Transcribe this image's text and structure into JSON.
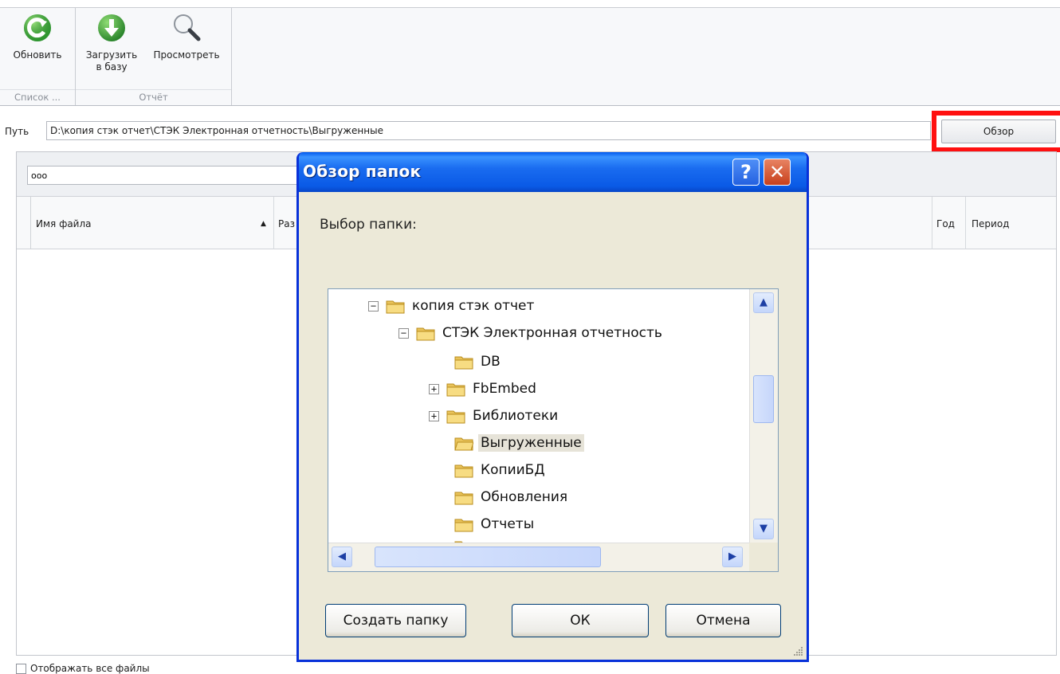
{
  "ribbon": {
    "refresh_label": "Обновить",
    "list_group_caption": "Список ...",
    "upload_label_line1": "Загрузить",
    "upload_label_line2": "в базу",
    "view_label": "Просмотреть",
    "report_group_caption": "Отчёт"
  },
  "path": {
    "label": "Путь",
    "value": "D:\\копия стэк отчет\\СТЭК Электронная отчетность\\Выгруженные",
    "browse_button": "Обзор"
  },
  "grid": {
    "filter_value": "ооо",
    "columns": [
      "Имя файла",
      "Раз",
      "Год",
      "Период"
    ],
    "show_all_label": "Отображать все файлы"
  },
  "dialog": {
    "title": "Обзор папок",
    "help_glyph": "?",
    "close_glyph": "✕",
    "caption": "Выбор папки:",
    "tree": [
      {
        "label": "копия стэк отчет",
        "expander": "−"
      },
      {
        "label": "СТЭК Электронная отчетность",
        "expander": "−"
      },
      {
        "label": "DB",
        "expander": ""
      },
      {
        "label": "FbEmbed",
        "expander": "+"
      },
      {
        "label": "Библиотеки",
        "expander": "+"
      },
      {
        "label": "Выгруженные",
        "expander": "",
        "selected": true
      },
      {
        "label": "КопииБД",
        "expander": ""
      },
      {
        "label": "Обновления",
        "expander": ""
      },
      {
        "label": "Отчеты",
        "expander": ""
      }
    ],
    "new_folder_button": "Создать папку",
    "ok_button": "ОК",
    "cancel_button": "Отмена"
  },
  "colors": {
    "accent_red": "#ff1010",
    "xp_title_blue": "#0a5ae6",
    "dialog_bg": "#ece9d8"
  },
  "icons": [
    "refresh-icon",
    "download-icon",
    "magnifier-icon",
    "folder-icon",
    "help-icon",
    "close-icon"
  ]
}
